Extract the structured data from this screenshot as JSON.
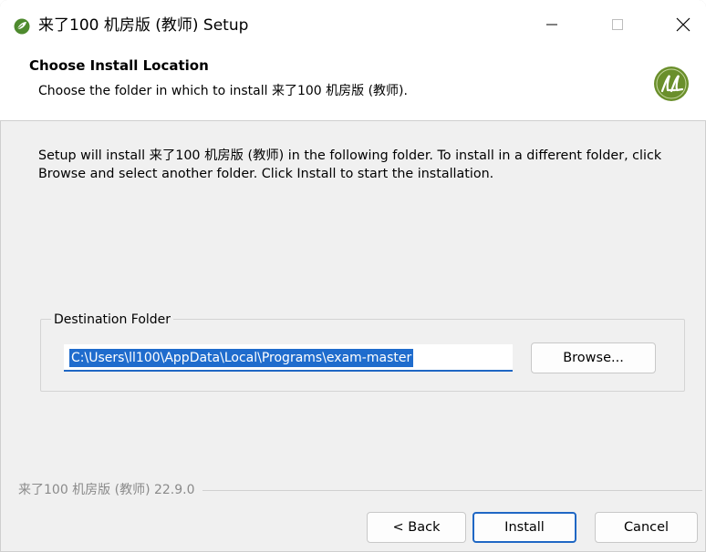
{
  "window": {
    "title": "来了100 机房版 (教师) Setup",
    "icon": "leaf-app-icon",
    "controls": [
      "minimize-icon",
      "maximize-icon",
      "close-icon"
    ]
  },
  "header": {
    "title": "Choose Install Location",
    "subtitle": "Choose the folder in which to install 来了100 机房版 (教师).",
    "logo": "ll-logo-icon"
  },
  "body": {
    "description": "Setup will install 来了100 机房版 (教师) in the following folder. To install in a different folder, click Browse and select another folder. Click Install to start the installation."
  },
  "destination": {
    "label": "Destination Folder",
    "path": "C:\\Users\\ll100\\AppData\\Local\\Programs\\exam-master",
    "browse_label": "Browse..."
  },
  "footer": {
    "version": "来了100 机房版 (教师) 22.9.0",
    "back_label": "< Back",
    "install_label": "Install",
    "cancel_label": "Cancel"
  },
  "colors": {
    "accent": "#1f67c4",
    "logo_green": "#6a8f2b",
    "window_bg": "#f0f0f0"
  }
}
